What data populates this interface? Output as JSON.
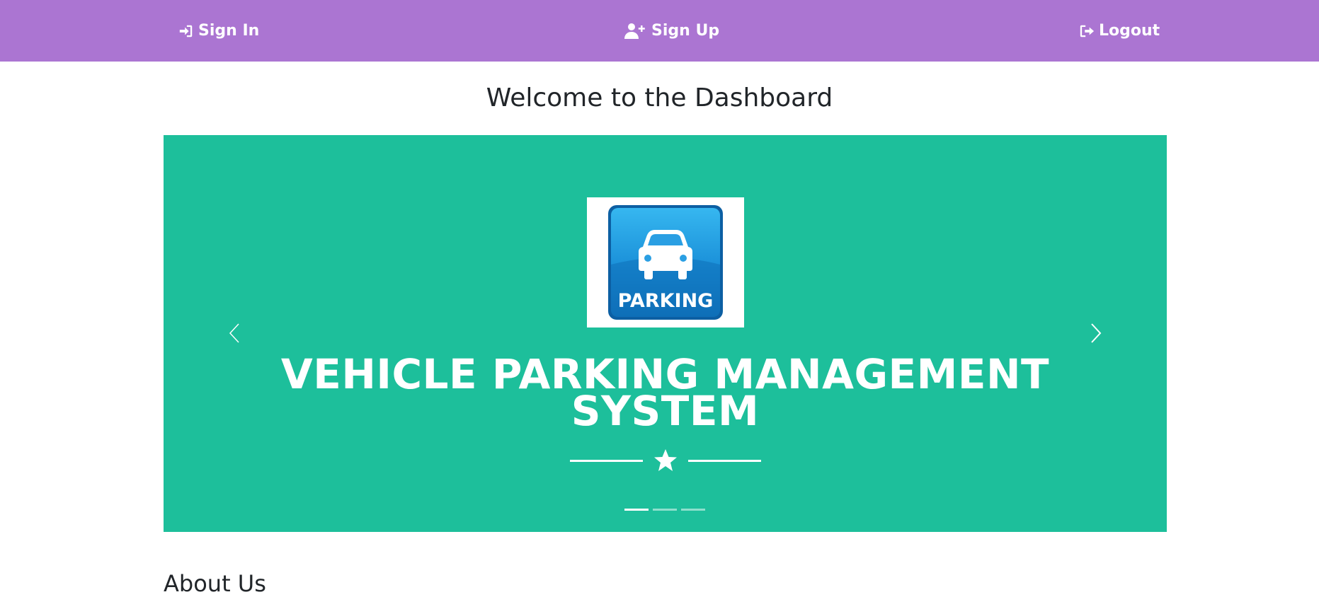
{
  "nav": {
    "signin_label": "Sign In",
    "signup_label": "Sign Up",
    "logout_label": "Logout"
  },
  "page": {
    "title": "Welcome to the Dashboard"
  },
  "carousel": {
    "logo_text": "PARKING",
    "heading_line1": "VEHICLE PARKING MANAGEMENT",
    "heading_line2": "SYSTEM",
    "slide_count": 3,
    "active_slide": 1
  },
  "about": {
    "heading": "About Us"
  },
  "colors": {
    "navbar": "#ab75d2",
    "carousel_bg": "#1dbf9b",
    "logo_blue": "#1a8fd8"
  },
  "icons": {
    "signin": "sign-in-icon",
    "signup": "user-plus-icon",
    "logout": "sign-out-icon",
    "prev": "chevron-left-icon",
    "next": "chevron-right-icon",
    "car": "car-icon",
    "star": "star-icon"
  }
}
